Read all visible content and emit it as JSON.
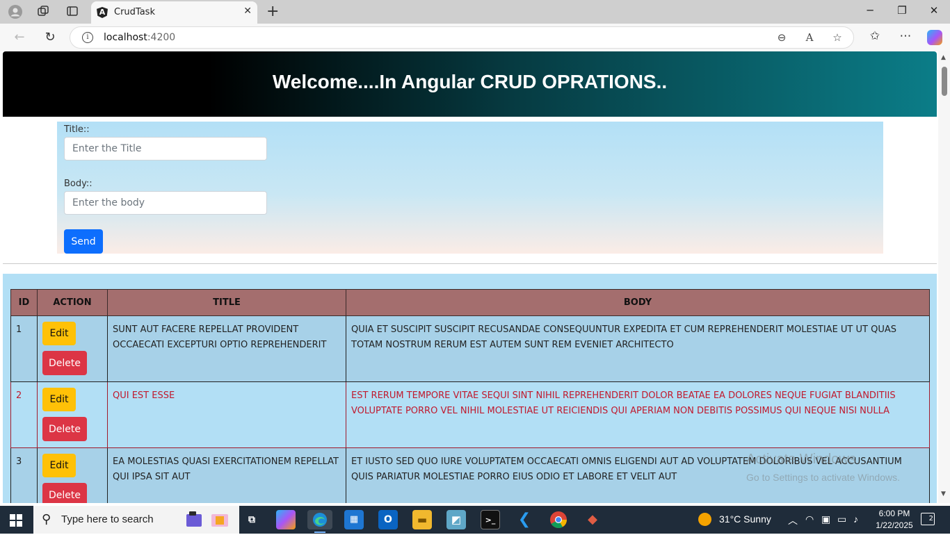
{
  "browser": {
    "tab_title": "CrudTask",
    "tab_logo_letter": "A",
    "url_host": "localhost",
    "url_port": ":4200"
  },
  "page": {
    "heading": "Welcome....In Angular CRUD OPRATIONS..",
    "form": {
      "title_label": "Title::",
      "title_placeholder": "Enter the Title",
      "body_label": "Body::",
      "body_placeholder": "Enter the body",
      "send_label": "Send"
    },
    "table": {
      "headers": {
        "id": "ID",
        "action": "ACTION",
        "title": "TITLE",
        "body": "BODY"
      },
      "edit_label": "Edit",
      "delete_label": "Delete",
      "rows": [
        {
          "id": "1",
          "title": "SUNT AUT FACERE REPELLAT PROVIDENT OCCAECATI EXCEPTURI OPTIO REPREHENDERIT",
          "body": "QUIA ET SUSCIPIT SUSCIPIT RECUSANDAE CONSEQUUNTUR EXPEDITA ET CUM REPREHENDERIT MOLESTIAE UT UT QUAS TOTAM NOSTRUM RERUM EST AUTEM SUNT REM EVENIET ARCHITECTO"
        },
        {
          "id": "2",
          "title": "QUI EST ESSE",
          "body": "EST RERUM TEMPORE VITAE SEQUI SINT NIHIL REPREHENDERIT DOLOR BEATAE EA DOLORES NEQUE FUGIAT BLANDITIIS VOLUPTATE PORRO VEL NIHIL MOLESTIAE UT REICIENDIS QUI APERIAM NON DEBITIS POSSIMUS QUI NEQUE NISI NULLA"
        },
        {
          "id": "3",
          "title": "EA MOLESTIAS QUASI EXERCITATIONEM REPELLAT QUI IPSA SIT AUT",
          "body": "ET IUSTO SED QUO IURE VOLUPTATEM OCCAECATI OMNIS ELIGENDI AUT AD VOLUPTATEM DOLORIBUS VEL ACCUSANTIUM QUIS PARIATUR MOLESTIAE PORRO EIUS ODIO ET LABORE ET VELIT AUT"
        }
      ]
    },
    "watermark": {
      "line1": "Activate Windows",
      "line2": "Go to Settings to activate Windows."
    }
  },
  "taskbar": {
    "search_placeholder": "Type here to search",
    "weather": "31°C  Sunny",
    "time": "6:00 PM",
    "date": "1/22/2025",
    "notification_count": "2"
  },
  "colors": {
    "header_gradient_end": "#0b7d88",
    "send_button": "#0d6efd",
    "edit_button": "#ffc107",
    "delete_button": "#dc3545",
    "table_header": "#a46e6e",
    "highlight_row_text": "#c0192d"
  },
  "icons": {
    "profile": "profile-icon",
    "workspaces": "workspaces-icon",
    "tab_actions": "tab-actions-icon",
    "back": "back-arrow-icon",
    "refresh": "refresh-icon",
    "info": "site-info-icon",
    "zoom": "zoom-out-icon",
    "read_aloud": "read-aloud-icon",
    "favorite": "star-icon",
    "favorites": "favorites-icon",
    "more": "more-icon",
    "copilot": "copilot-icon"
  }
}
